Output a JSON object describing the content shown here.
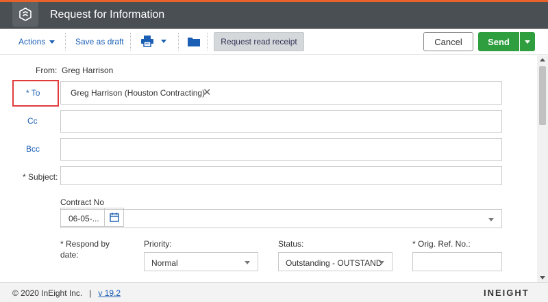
{
  "window": {
    "title": "Request for Information"
  },
  "toolbar": {
    "actions_label": "Actions",
    "save_draft_label": "Save as draft",
    "read_receipt_label": "Request read receipt",
    "cancel_label": "Cancel",
    "send_label": "Send"
  },
  "form": {
    "from_label": "From:",
    "from_value": "Greg Harrison",
    "to_label": "* To",
    "to_recipient": "Greg Harrison (Houston Contracting)",
    "cc_label": "Cc",
    "bcc_label": "Bcc",
    "subject_label": "* Subject:",
    "subject_value": "",
    "contract_label": "Contract No",
    "contract_value": "",
    "respond_label_line1": "* Respond by",
    "respond_label_line2": "date:",
    "respond_value": "06-05-...",
    "priority_label": "Priority:",
    "priority_value": "Normal",
    "status_label": "Status:",
    "status_value": "Outstanding - OUTSTAND",
    "orig_ref_label": "* Orig. Ref. No.:",
    "orig_ref_value": ""
  },
  "footer": {
    "copyright": "© 2020 InEight Inc.",
    "separator": "|",
    "version": "v 19.2",
    "brand": "INEIGHT"
  },
  "colors": {
    "accent": "#e8622a",
    "titlebar": "#4a4f54",
    "link": "#1a5fb4",
    "send": "#2e9e3e",
    "highlight": "#e03b3b"
  }
}
